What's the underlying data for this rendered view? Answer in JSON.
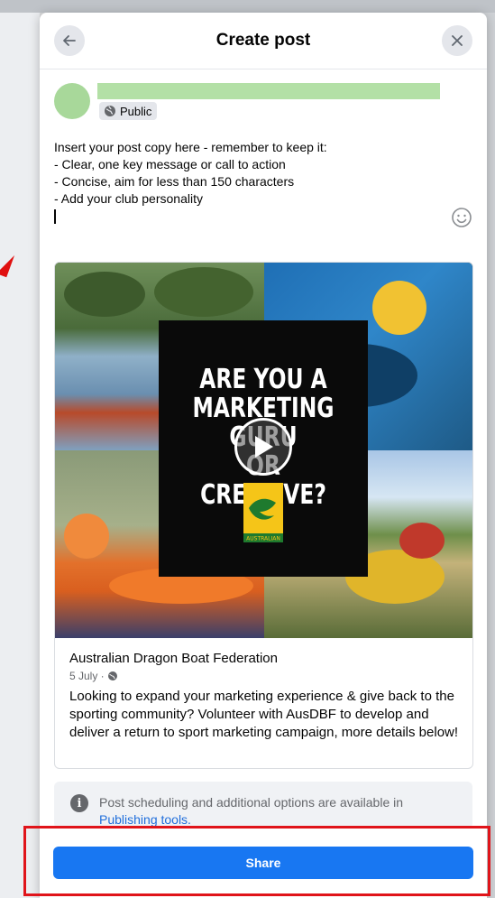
{
  "dialog": {
    "title": "Create post",
    "back_icon": "arrow-left-icon",
    "close_icon": "close-icon"
  },
  "composer": {
    "audience_label": "Public",
    "audience_icon": "globe-icon",
    "post_text": "Insert your post copy here - remember to keep it:\n- Clear, one key message or call to action\n- Concise, aim for less than 150 characters\n- Add your club personality",
    "emoji_icon": "smiley-icon"
  },
  "preview": {
    "image_headline": "ARE YOU A\nMARKETING GURU\nOR CREATIVE?",
    "logo_text": "AUSTRALIAN",
    "page_name": "Australian Dragon Boat Federation",
    "date": "5 July ·",
    "description": "Looking to expand your marketing experience & give back to the sporting community? Volunteer with AusDBF to develop and deliver a return to sport marketing campaign, more details below!"
  },
  "notice": {
    "text": "Post scheduling and additional options are available in",
    "link": "Publishing tools."
  },
  "actions": {
    "share_label": "Share"
  },
  "colors": {
    "accent": "#1877f2",
    "highlight": "#e0141a"
  }
}
